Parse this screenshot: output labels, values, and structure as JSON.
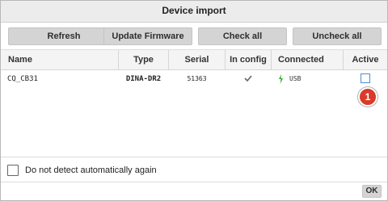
{
  "dialog": {
    "title": "Device import"
  },
  "toolbar": {
    "refresh_label": "Refresh",
    "update_firmware_label": "Update Firmware",
    "check_all_label": "Check all",
    "uncheck_all_label": "Uncheck all"
  },
  "table": {
    "columns": [
      "Name",
      "Type",
      "Serial",
      "In config",
      "Connected",
      "Active"
    ],
    "rows": [
      {
        "name": "CQ_CB31",
        "type": "DINA-DR2",
        "serial": "51363",
        "in_config": "checkmark-icon",
        "connected": "USB",
        "active": false
      }
    ]
  },
  "annotation": {
    "badge": "1"
  },
  "footer": {
    "no_detect_label": "Do not detect automatically again",
    "no_detect_checked": false,
    "ok_label": "OK"
  },
  "colors": {
    "button_bg": "#d4d4d4",
    "active_box_border": "#4a8fd6",
    "badge_bg": "#d93a2a",
    "connected_icon": "#3aa635"
  }
}
